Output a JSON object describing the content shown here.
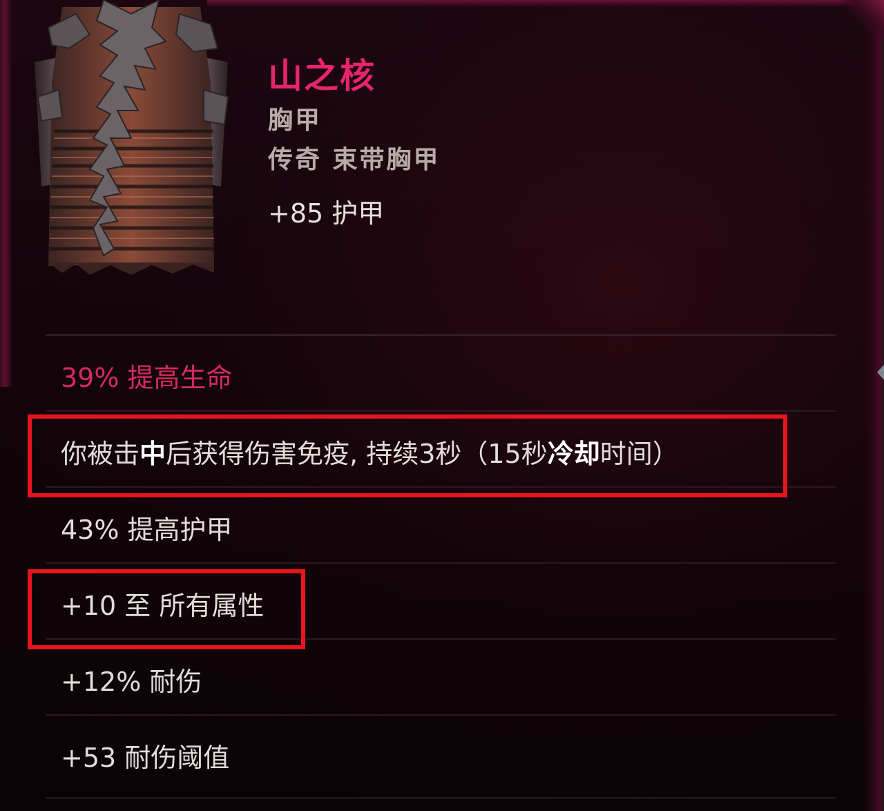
{
  "item": {
    "name": "山之核",
    "slot": "胸甲",
    "rarity_type": "传奇 束带胸甲",
    "armor_stat": "+85 护甲"
  },
  "affixes": [
    {
      "text": "39% 提高生命",
      "kind": "implicit"
    },
    {
      "text_parts": [
        "你被击",
        "中",
        "后获得伤害免疫, 持续3秒（15秒",
        "冷却",
        "时间）"
      ],
      "kind": "unique",
      "highlighted": true
    },
    {
      "text": "43% 提高护甲",
      "kind": "normal"
    },
    {
      "text": "+10 至 所有属性",
      "kind": "normal",
      "highlighted": true
    },
    {
      "text": "+12% 耐伤",
      "kind": "normal"
    },
    {
      "text": "+53 耐伤阈值",
      "kind": "normal"
    }
  ],
  "colors": {
    "item_name": "#e8246a",
    "implicit": "#d42a60",
    "highlight_box": "#e8141e",
    "text": "#e2dcda"
  },
  "icons": {
    "item_image": "chest-armor-icon"
  }
}
